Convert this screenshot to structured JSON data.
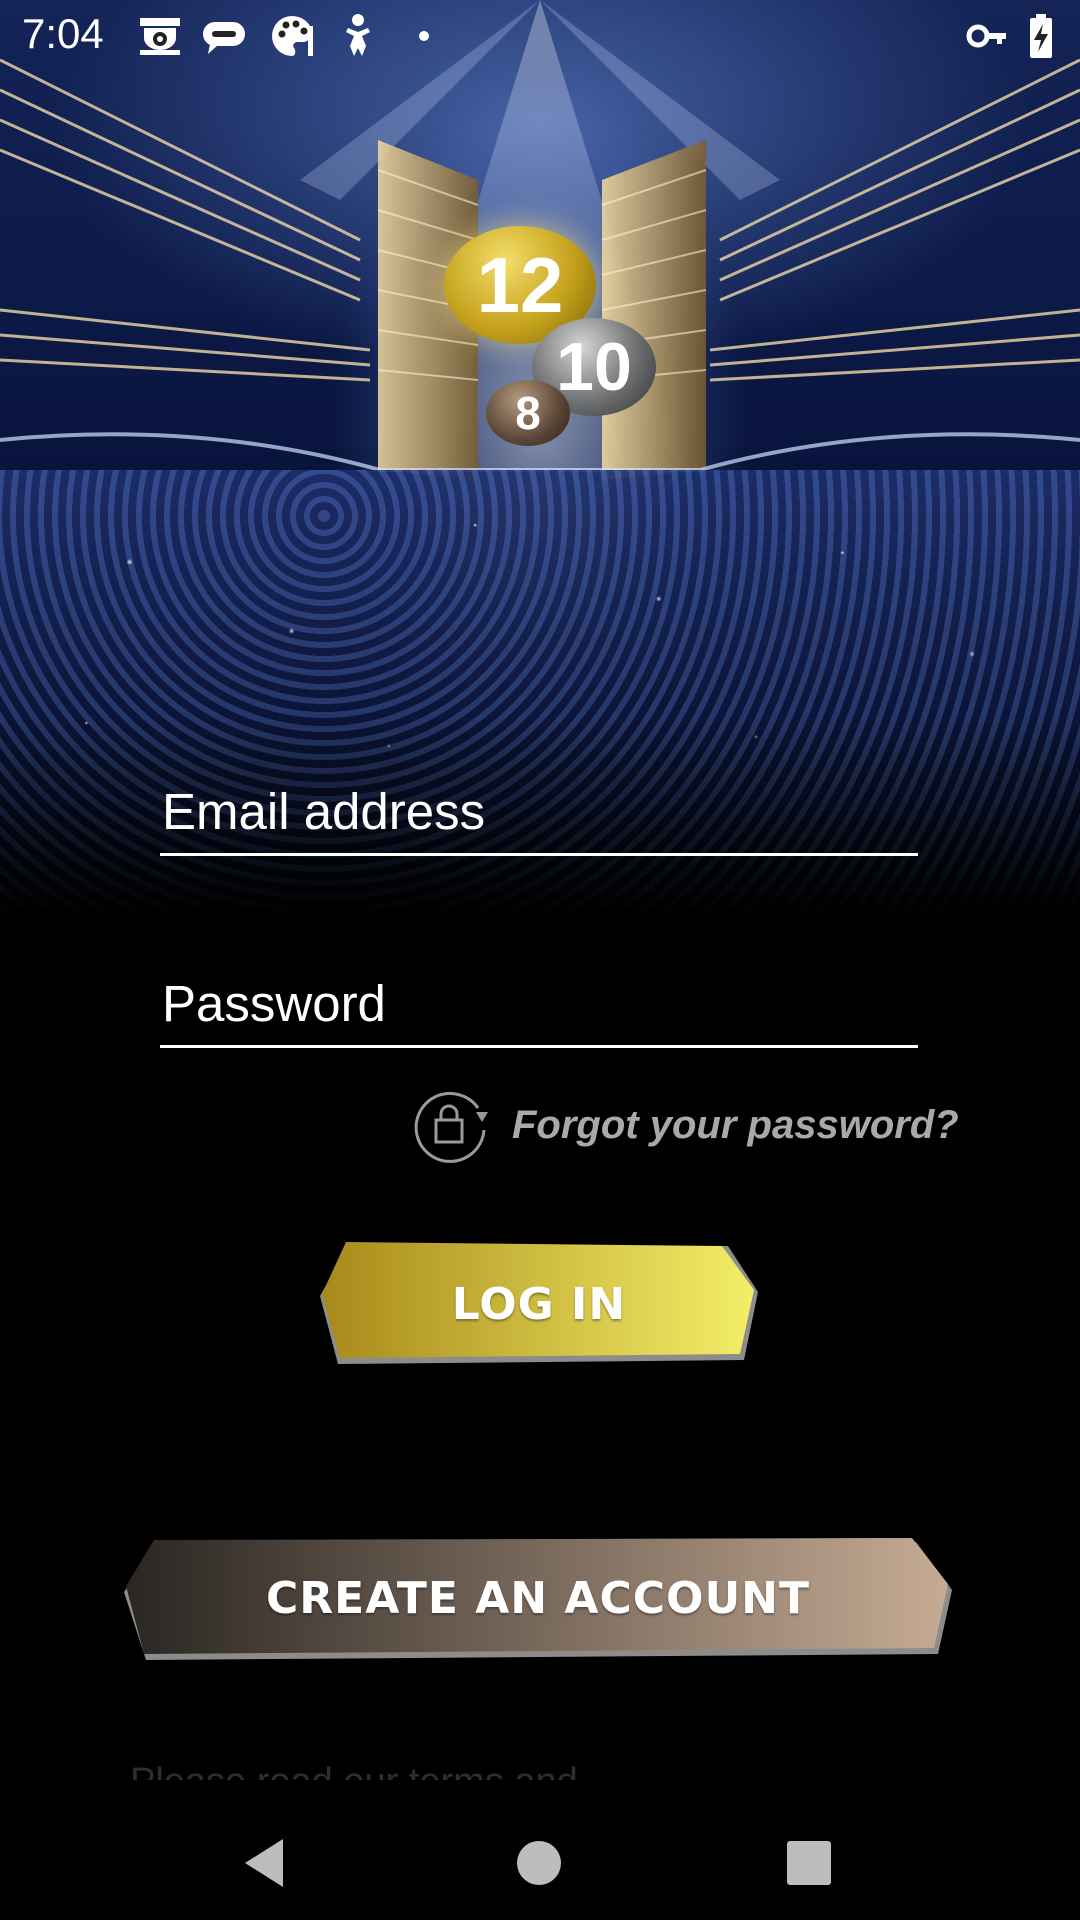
{
  "status_bar": {
    "time": "7:04",
    "left_icons": [
      "cctv-icon",
      "chat-bubble-icon",
      "palette-icon",
      "child-icon",
      "dot-icon"
    ],
    "right_icons": [
      "vpn-key-icon",
      "battery-charging-icon"
    ]
  },
  "hero": {
    "logo_numbers": [
      "12",
      "10",
      "8"
    ]
  },
  "form": {
    "email_placeholder": "Email address",
    "email_value": "",
    "password_placeholder": "Password",
    "password_value": "",
    "forgot_password": "Forgot your password?"
  },
  "buttons": {
    "login": "LOG IN",
    "create_account": "CREATE AN ACCOUNT"
  },
  "footer": {
    "partial_text": "Please read our terms and"
  },
  "nav_bar": {
    "icons": [
      "back-icon",
      "home-icon",
      "recents-icon"
    ]
  },
  "colors": {
    "login_gradient_start": "#a8891a",
    "login_gradient_end": "#f4ee68",
    "create_gradient_start": "#2a2622",
    "create_gradient_end": "#c6ab94",
    "forgot_text": "#a9a9a9"
  }
}
